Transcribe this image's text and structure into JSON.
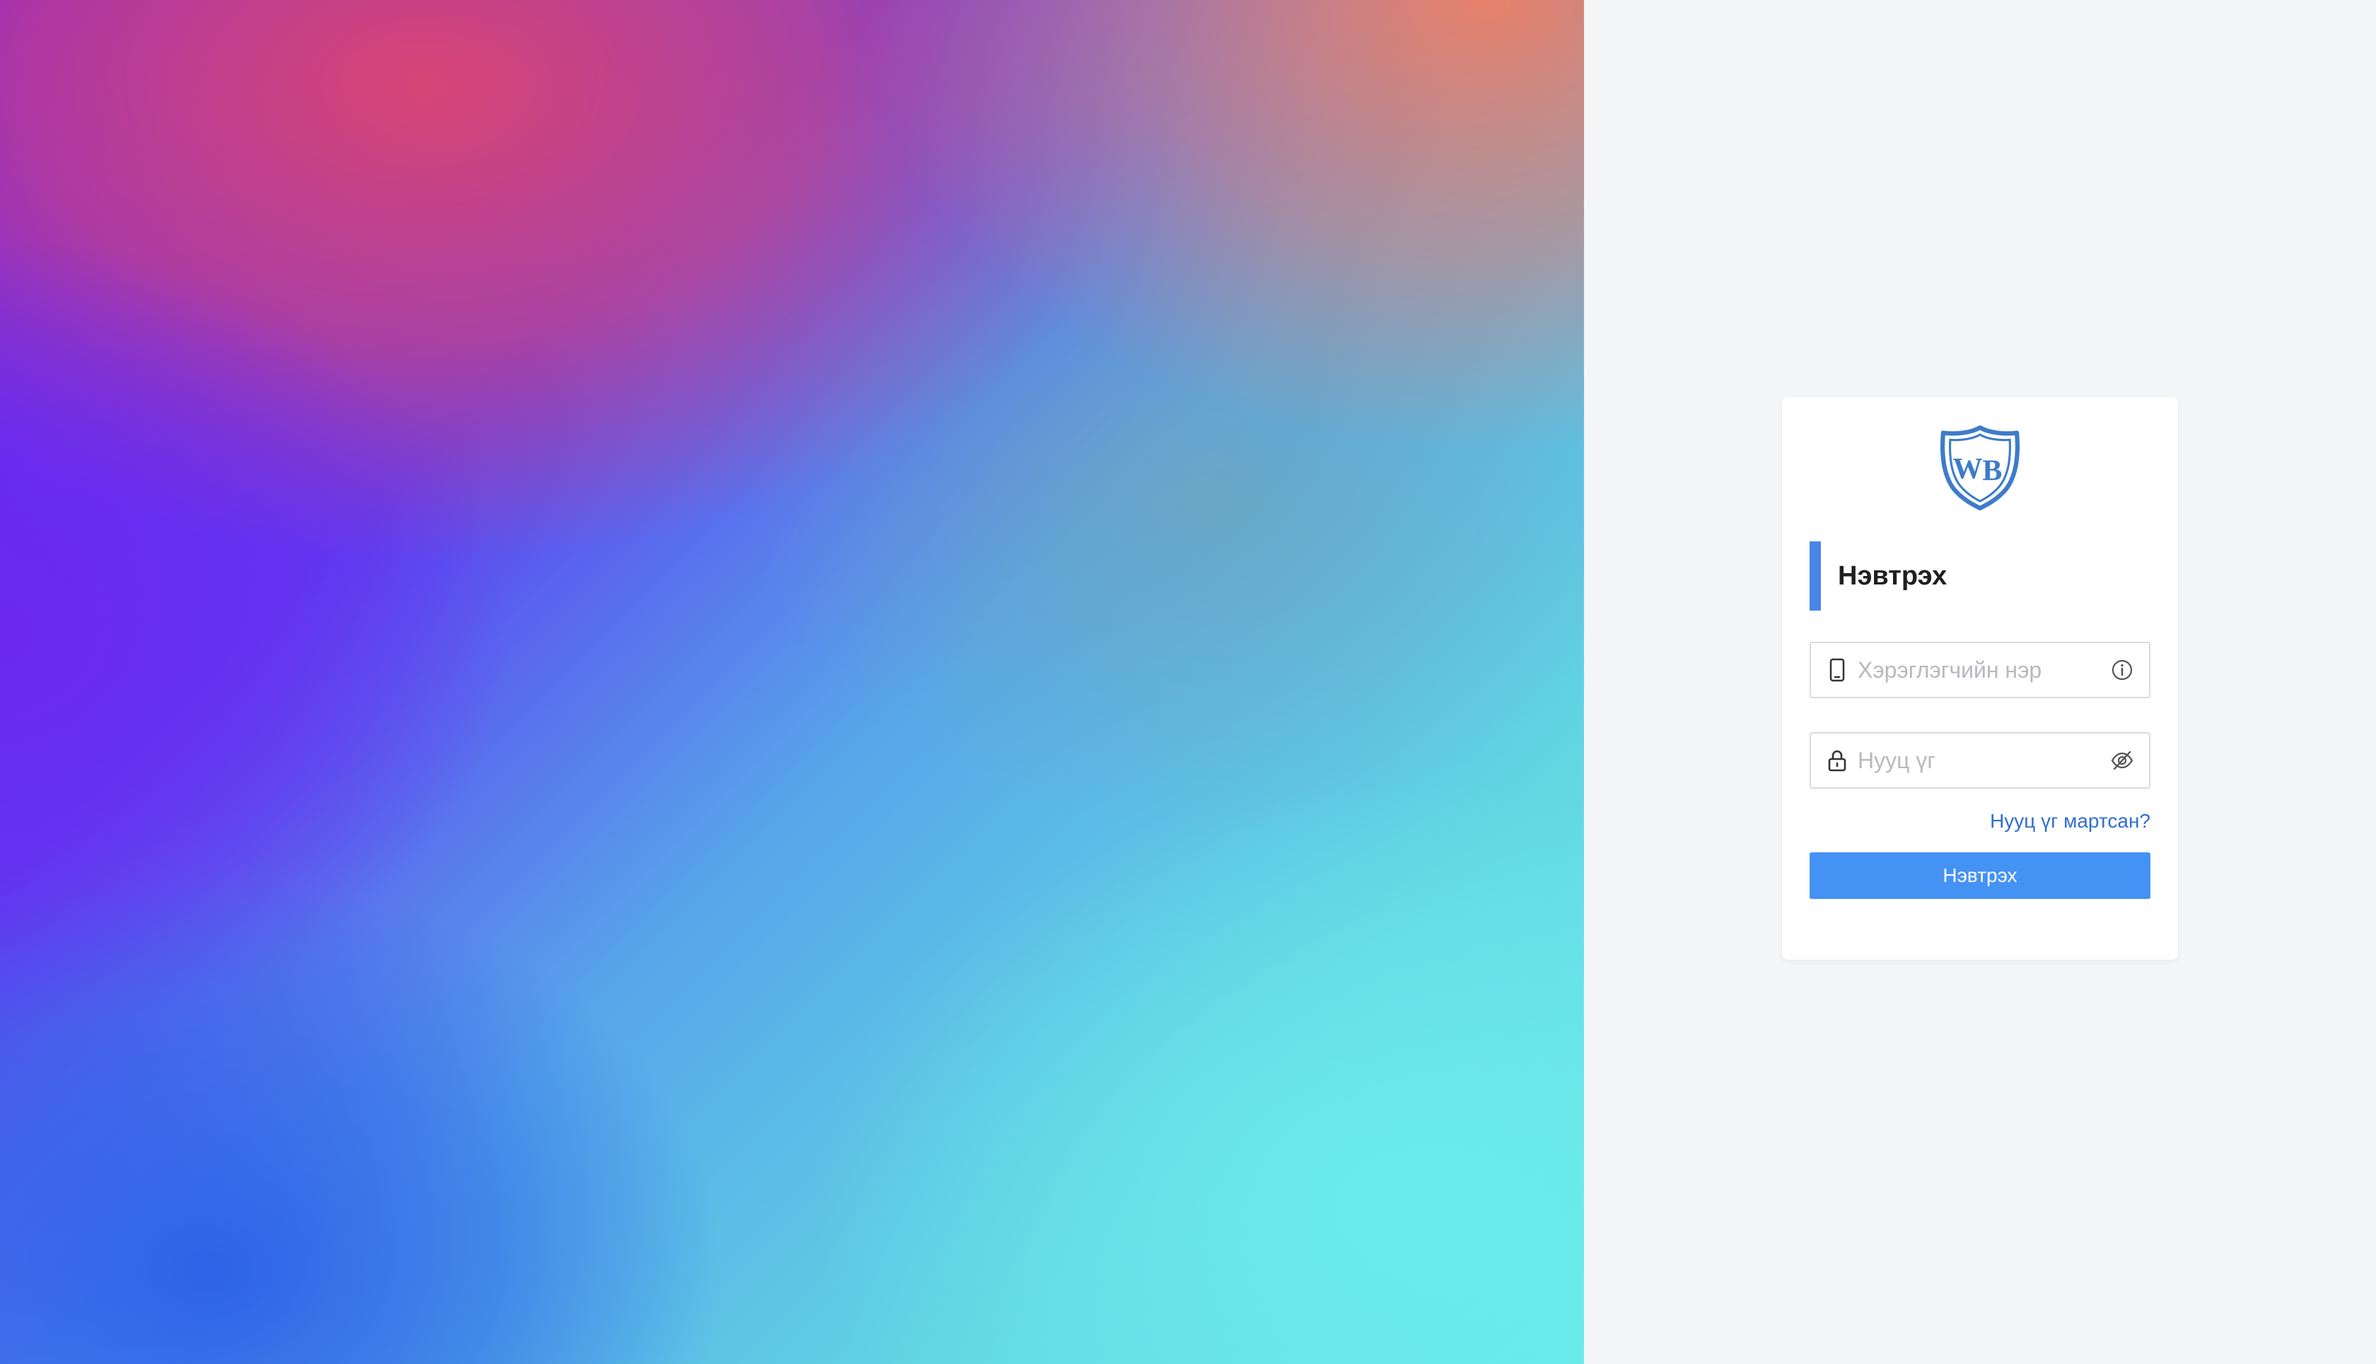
{
  "hero": {
    "colors": {
      "pink": "#de466e",
      "coral": "#ee8064",
      "violet": "#6c28f0",
      "blue": "#2c60e8",
      "cyan": "#6cecec"
    }
  },
  "card": {
    "logo_icon": "wb-shield-logo",
    "title": "Нэвтрэх",
    "accent_color": "#4a86e8",
    "username": {
      "value": "",
      "placeholder": "Хэрэглэгчийн нэр",
      "lead_icon": "mobile-phone-icon",
      "trail_icon": "info-circle-icon"
    },
    "password": {
      "value": "",
      "placeholder": "Нууц үг",
      "lead_icon": "lock-icon",
      "trail_icon": "eye-slash-icon"
    },
    "forgot_label": "Нууц үг мартсан?",
    "submit_label": "Нэвтрэх",
    "button_color": "#4592f5",
    "link_color": "#2f6fcf"
  }
}
